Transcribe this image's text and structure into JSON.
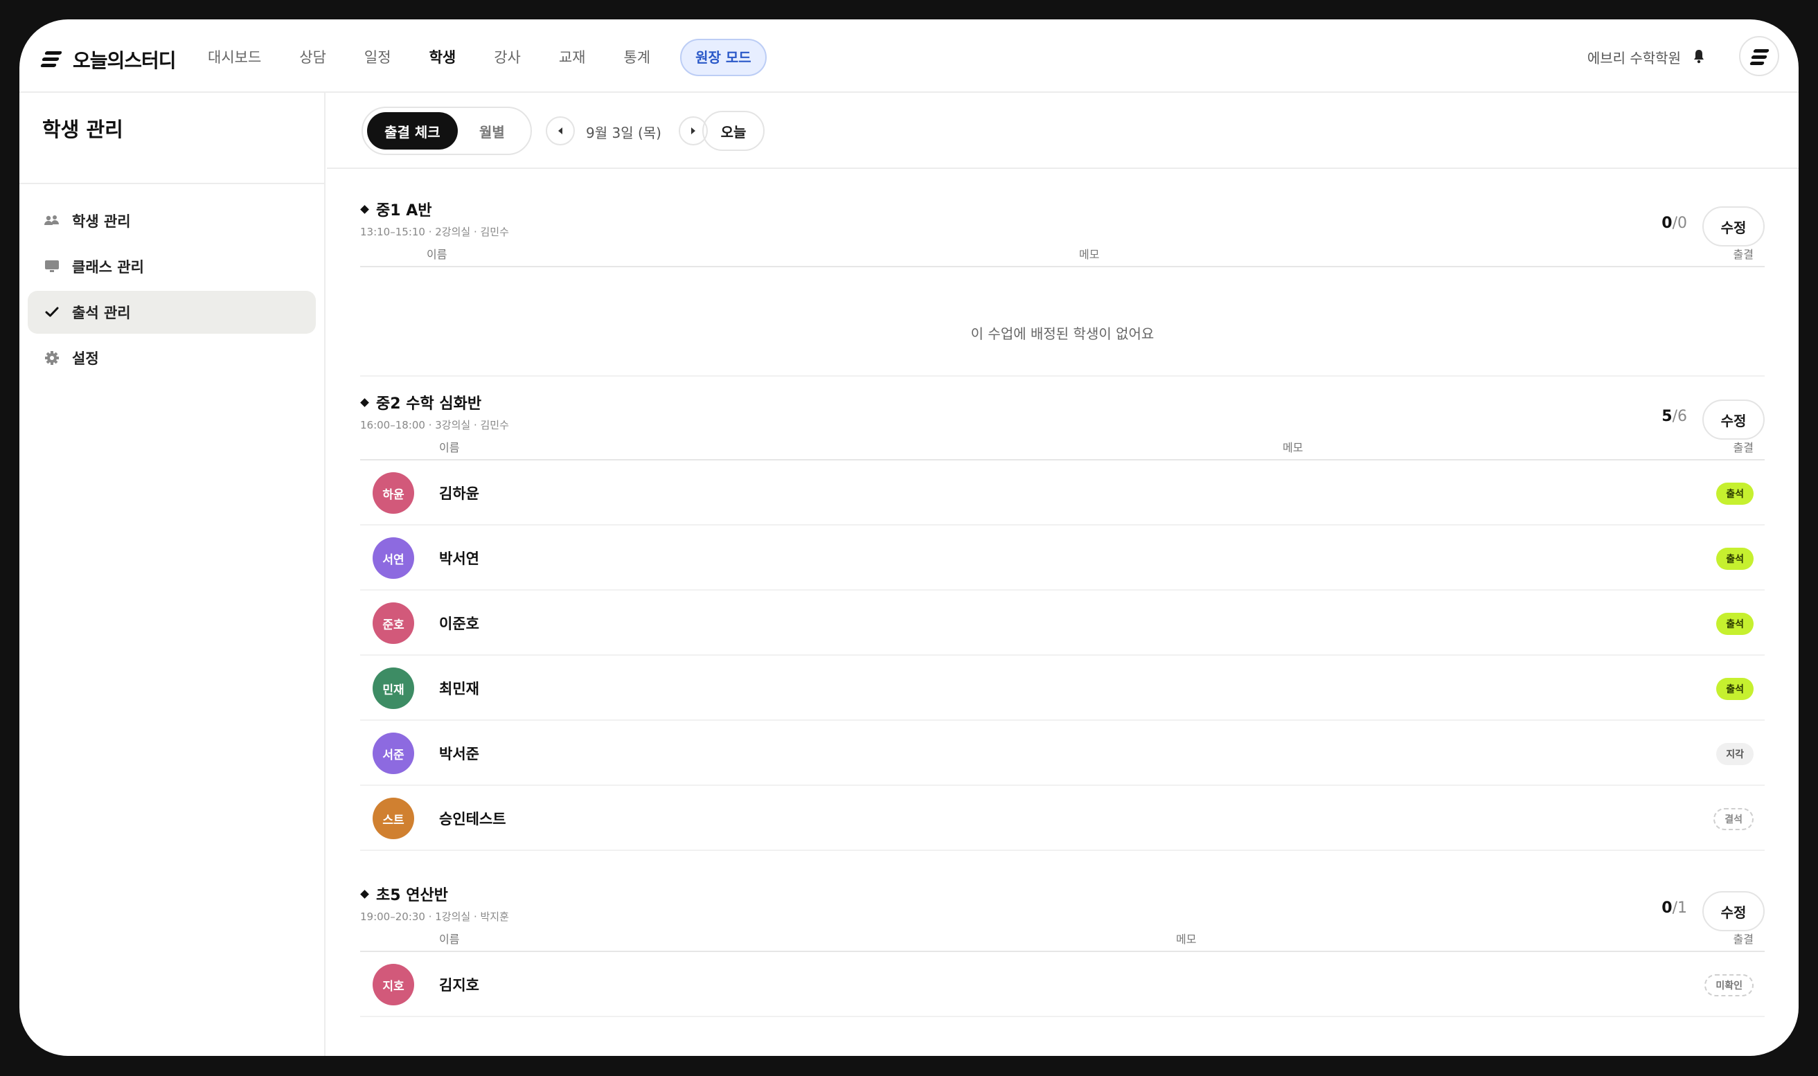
{
  "app": {
    "name": "오늘의스터디"
  },
  "nav": {
    "items": [
      {
        "label": "대시보드",
        "active": false
      },
      {
        "label": "상담",
        "active": false
      },
      {
        "label": "일정",
        "active": false
      },
      {
        "label": "학생",
        "active": true
      },
      {
        "label": "강사",
        "active": false
      },
      {
        "label": "교재",
        "active": false
      },
      {
        "label": "통계",
        "active": false
      }
    ],
    "mode_button": "원장 모드",
    "academy": "에브리 수학학원",
    "icons": {
      "bell": "bell-icon",
      "profile": "profile-avatar"
    }
  },
  "sidebar": {
    "title": "학생 관리",
    "items": [
      {
        "label": "학생 관리",
        "icon": "users-icon",
        "active": false
      },
      {
        "label": "클래스 관리",
        "icon": "monitor-icon",
        "active": false
      },
      {
        "label": "출석 관리",
        "icon": "check-icon",
        "active": true
      },
      {
        "label": "설정",
        "icon": "gear-icon",
        "active": false
      }
    ]
  },
  "toolbar": {
    "view_active": "출결 체크",
    "view_inactive": "월별",
    "date": "9월 3일 (목)",
    "today": "오늘"
  },
  "columns": {
    "name": "이름",
    "memo": "메모",
    "attendance": "출결"
  },
  "classes": [
    {
      "title": "중1 A반",
      "meta": "13:10–15:10 · 2강의실 · 김민수",
      "present": "0",
      "total": "/0",
      "edit": "수정",
      "empty_message": "이 수업에 배정된 학생이 없어요",
      "students": []
    },
    {
      "title": "중2 수학 심화반",
      "meta": "16:00–18:00 · 3강의실 · 김민수",
      "present": "5",
      "total": "/6",
      "edit": "수정",
      "students": [
        {
          "avatar": "하윤",
          "name": "김하윤",
          "color": "#d2597a",
          "status": "출석",
          "kind": "present"
        },
        {
          "avatar": "서연",
          "name": "박서연",
          "color": "#8d6ae0",
          "status": "출석",
          "kind": "present"
        },
        {
          "avatar": "준호",
          "name": "이준호",
          "color": "#d2597a",
          "status": "출석",
          "kind": "present"
        },
        {
          "avatar": "민재",
          "name": "최민재",
          "color": "#3d8c64",
          "status": "출석",
          "kind": "present"
        },
        {
          "avatar": "서준",
          "name": "박서준",
          "color": "#8d6ae0",
          "status": "지각",
          "kind": "late"
        },
        {
          "avatar": "스트",
          "name": "승인테스트",
          "color": "#d08030",
          "status": "결석",
          "kind": "absent"
        }
      ]
    },
    {
      "title": "초5 연산반",
      "meta": "19:00–20:30 · 1강의실 · 박지훈",
      "present": "0",
      "total": "/1",
      "edit": "수정",
      "students": [
        {
          "avatar": "지호",
          "name": "김지호",
          "color": "#d2597a",
          "status": "미확인",
          "kind": "unknown"
        }
      ]
    }
  ]
}
